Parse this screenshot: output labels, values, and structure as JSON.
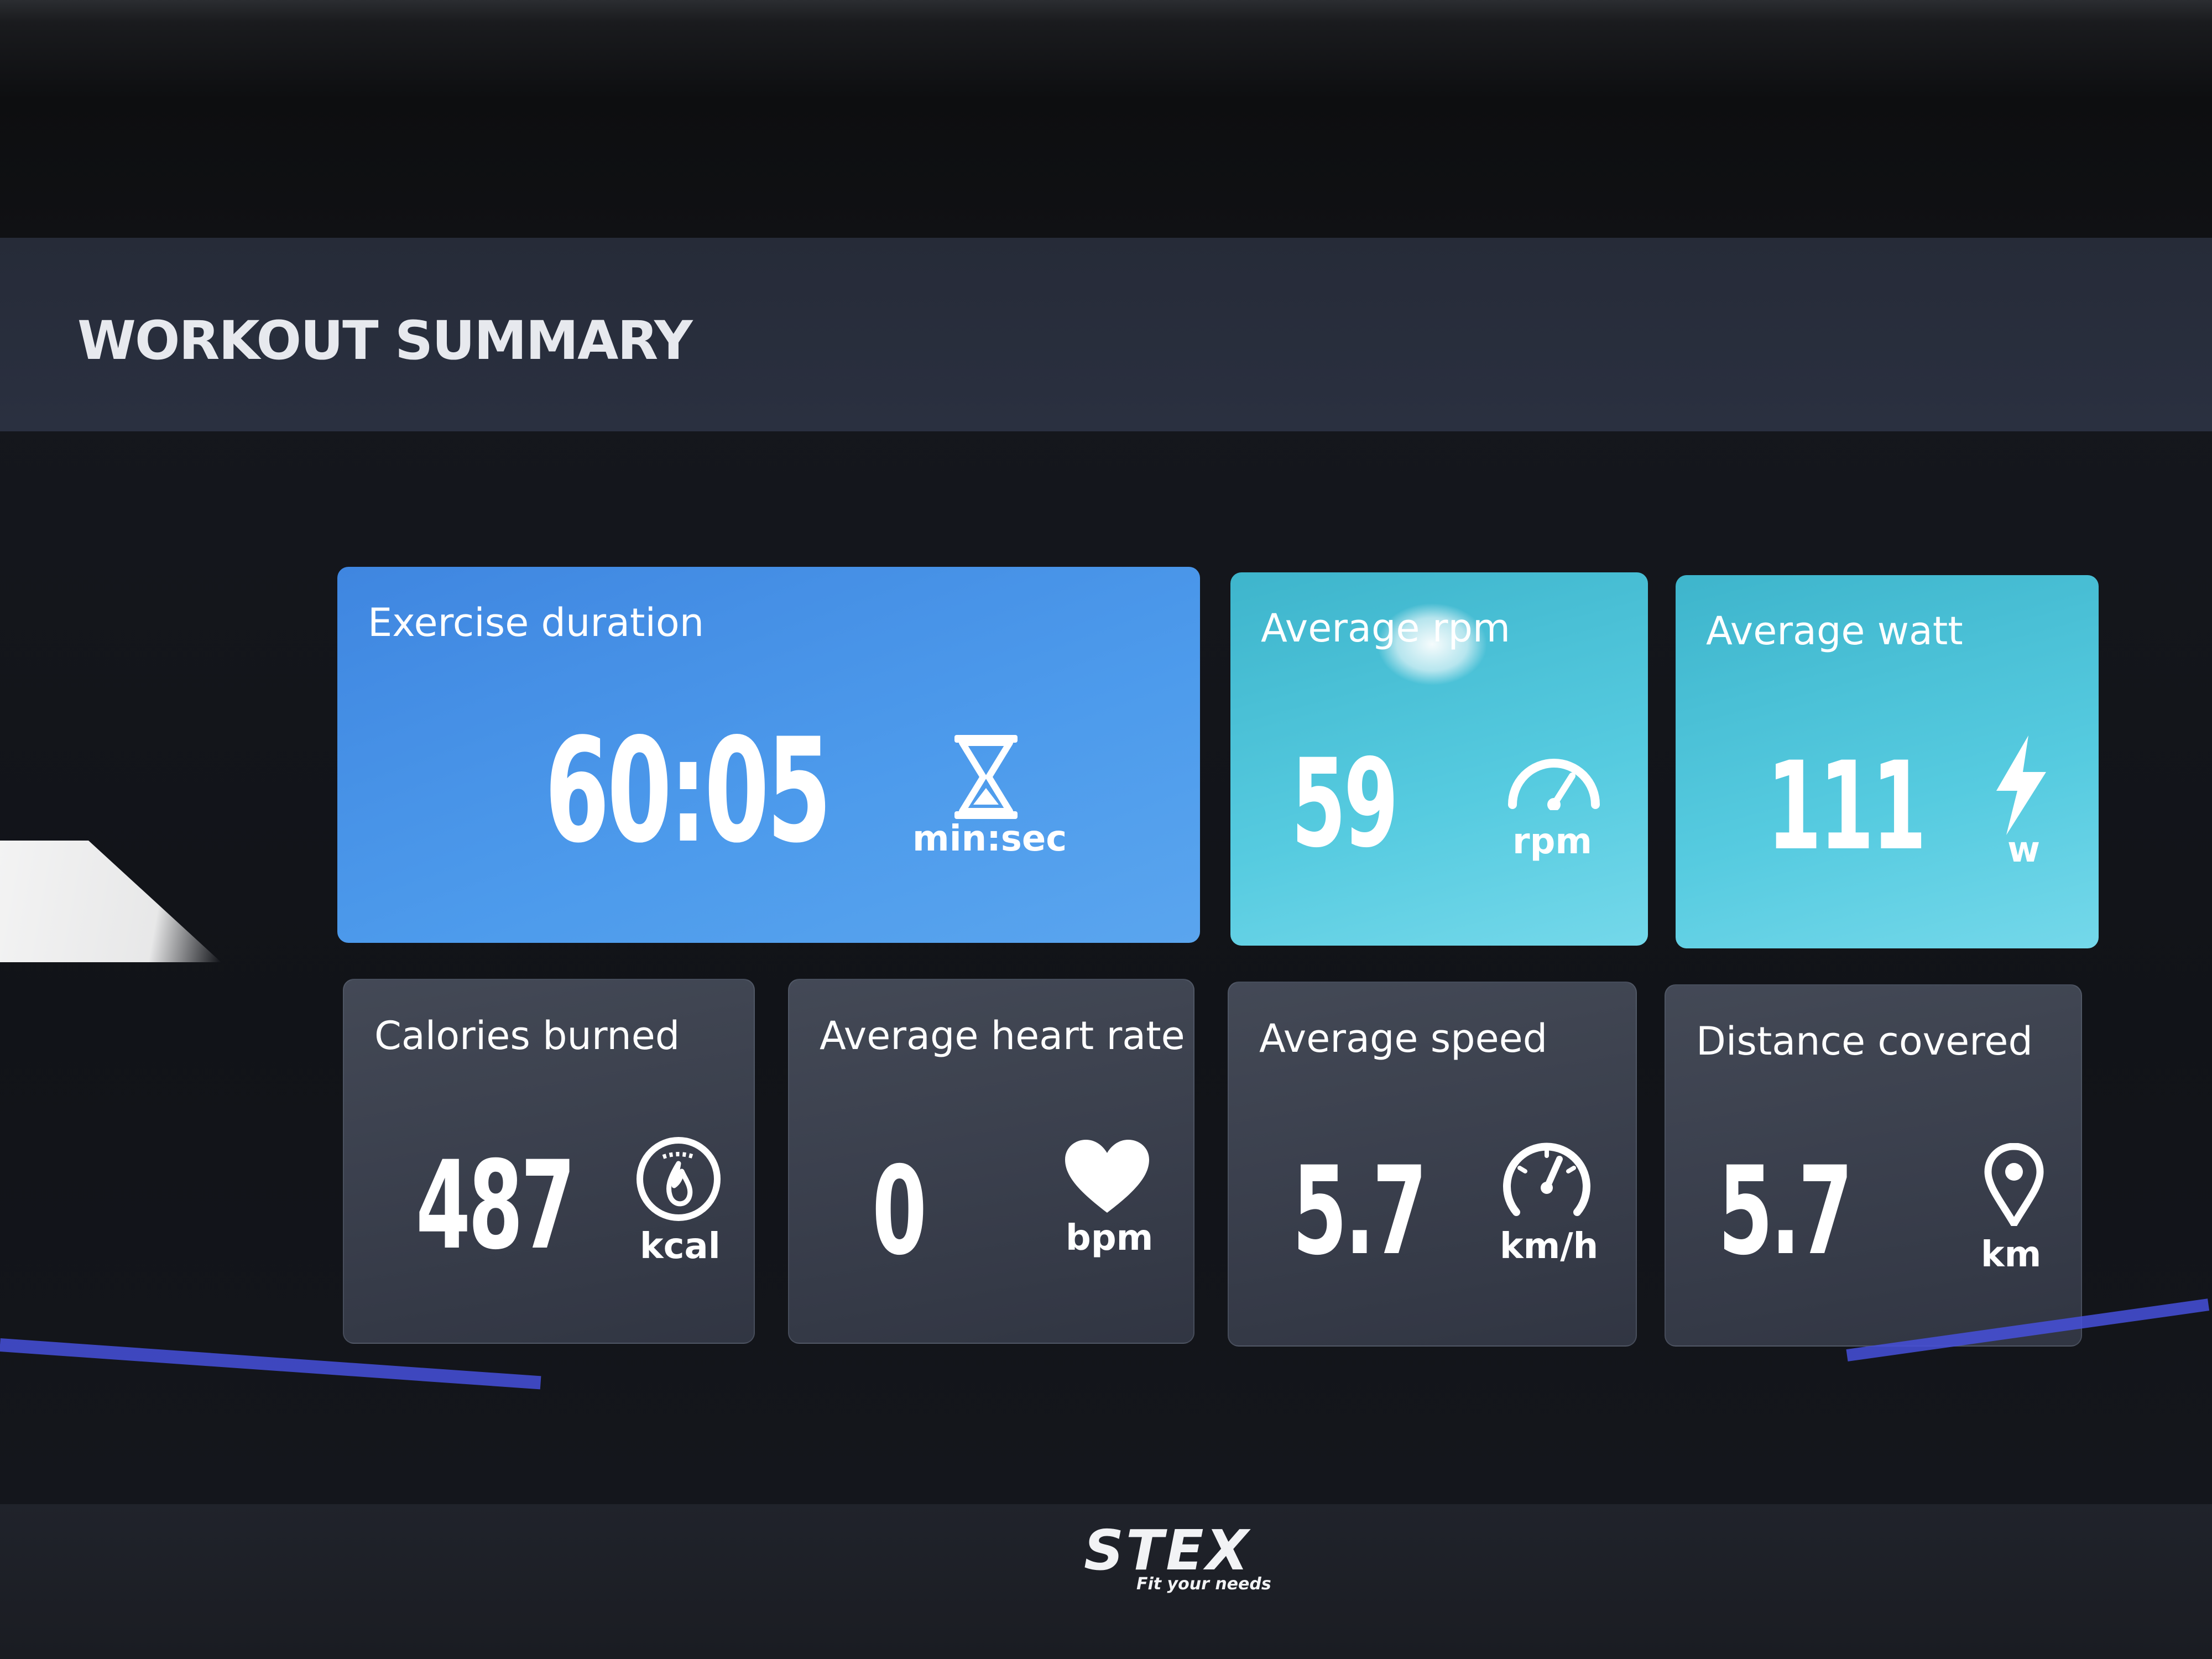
{
  "header": {
    "title": "WORKOUT SUMMARY"
  },
  "tiles": {
    "duration": {
      "label": "Exercise duration",
      "value": "60:05",
      "unit": "min:sec",
      "icon": "hourglass-icon"
    },
    "rpm": {
      "label": "Average rpm",
      "value": "59",
      "unit": "rpm",
      "icon": "gauge-icon"
    },
    "watt": {
      "label": "Average watt",
      "value": "111",
      "unit": "w",
      "icon": "lightning-icon"
    },
    "calories": {
      "label": "Calories burned",
      "value": "487",
      "unit": "kcal",
      "icon": "calorie-flame-icon"
    },
    "heart_rate": {
      "label": "Average heart rate",
      "value": "0",
      "unit": "bpm",
      "icon": "heart-icon"
    },
    "speed": {
      "label": "Average speed",
      "value": "5.7",
      "unit": "km/h",
      "icon": "speedometer-icon"
    },
    "distance": {
      "label": "Distance covered",
      "value": "5.7",
      "unit": "km",
      "icon": "location-pin-icon"
    }
  },
  "footer": {
    "brand": "STEX",
    "tagline": "Fit your needs"
  },
  "colors": {
    "primary_tile": "#4d9bec",
    "accent_tile": "#56cbe0",
    "secondary_tile": "#3e4453"
  }
}
